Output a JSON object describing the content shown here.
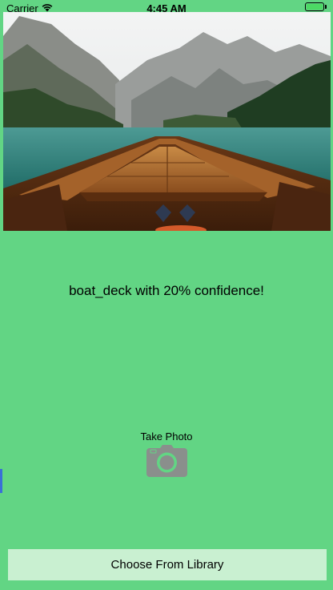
{
  "status_bar": {
    "carrier": "Carrier",
    "time": "4:45 AM",
    "icons": [
      "wifi-icon",
      "battery-icon"
    ],
    "battery_level": 1.0
  },
  "photo": {
    "description_icon": "boat-deck-lake-photo"
  },
  "result": {
    "text": "boat_deck with 20% confidence!"
  },
  "camera": {
    "label": "Take Photo",
    "icon": "camera-icon"
  },
  "library": {
    "label": "Choose From Library"
  },
  "colors": {
    "background": "#62d584",
    "library_button": "#c9f0d1",
    "camera_icon": "#8a8f8c"
  }
}
